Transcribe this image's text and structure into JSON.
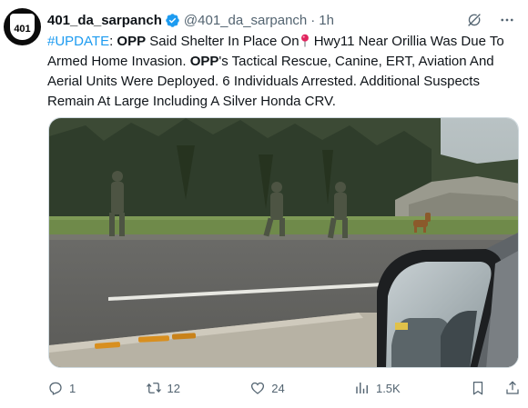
{
  "author": {
    "display_name": "401_da_sarpanch",
    "handle": "@401_da_sarpanch",
    "separator": "·",
    "time": "1h",
    "avatar_text": "401"
  },
  "tweet": {
    "hashtag": "#UPDATE",
    "colon": ": ",
    "org1": "OPP",
    "text1": " Said Shelter In Place On",
    "text2": " Hwy11 Near Orillia Was Due To Armed Home Invasion. ",
    "org2": "OPP",
    "text3": "'s Tactical Rescue, Canine, ERT, Aviation And Aerial Units Were Deployed. 6 Individuals Arrested. Additional Suspects Remain At Large Including A Silver Honda CRV."
  },
  "actions": {
    "replies": "1",
    "reposts": "12",
    "likes": "24",
    "views": "1.5K"
  },
  "colors": {
    "accent": "#1d9bf0",
    "text": "#0f1419",
    "muted": "#536471"
  },
  "icons": {
    "verified": "verified-badge-icon",
    "grok": "grok-icon",
    "more": "more-icon",
    "pin": "round-pushpin-icon",
    "reply": "reply-icon",
    "repost": "repost-icon",
    "like": "heart-icon",
    "views": "views-icon",
    "bookmark": "bookmark-icon",
    "share": "share-icon"
  }
}
